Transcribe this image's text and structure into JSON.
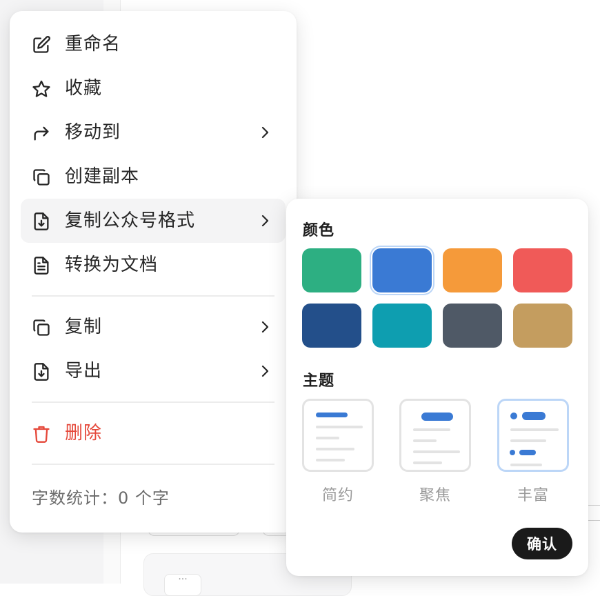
{
  "menu": {
    "items": [
      {
        "label": "重命名",
        "icon": "edit-icon"
      },
      {
        "label": "收藏",
        "icon": "star-icon"
      },
      {
        "label": "移动到",
        "icon": "forward-arrow-icon"
      },
      {
        "label": "创建副本",
        "icon": "copy-icon"
      },
      {
        "label": "复制公众号格式",
        "icon": "file-download-icon"
      },
      {
        "label": "转换为文档",
        "icon": "document-icon"
      },
      {
        "label": "复制",
        "icon": "copy-icon"
      },
      {
        "label": "导出",
        "icon": "file-download-icon"
      },
      {
        "label": "删除",
        "icon": "trash-icon"
      }
    ],
    "word_count": "字数统计：0 个字"
  },
  "submenu": {
    "color_title": "颜色",
    "colors": [
      "#2daf82",
      "#3a7ad4",
      "#f59a3a",
      "#f05a58",
      "#234f8a",
      "#0e9eb0",
      "#4f5966",
      "#c49d5f"
    ],
    "selected_color": "#3a7ad4",
    "theme_title": "主题",
    "themes": [
      {
        "label": "简约"
      },
      {
        "label": "聚焦"
      },
      {
        "label": "丰富"
      }
    ],
    "selected_theme": "丰富",
    "confirm_label": "确认"
  },
  "colors": {
    "accent": "#3a7ad4",
    "danger": "#e5483a",
    "selection_ring": "#bcd6f7"
  }
}
